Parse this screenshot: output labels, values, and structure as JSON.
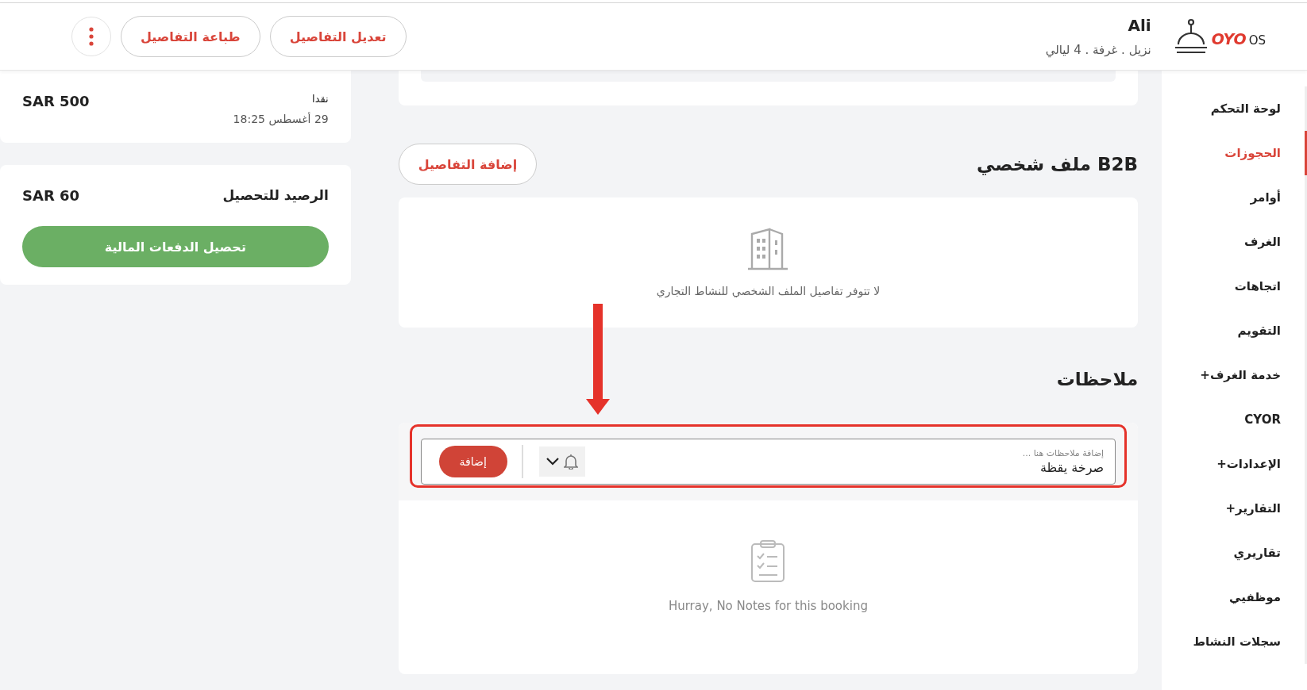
{
  "header": {
    "logo": {
      "mark": "OYO",
      "suffix": "OS"
    },
    "guest_name": "Ali",
    "stay_summary": "نزيل . غرفة . 4 ليالي",
    "buttons": [
      {
        "label": "تعديل التفاصيل"
      },
      {
        "label": "طباعة التفاصيل"
      }
    ]
  },
  "sidebar": {
    "items": [
      {
        "label": "لوحة التحكم",
        "selected": false
      },
      {
        "label": "الحجوزات",
        "selected": true
      },
      {
        "label": "أوامر",
        "selected": false
      },
      {
        "label": "الغرف",
        "selected": false
      },
      {
        "label": "اتجاهات",
        "selected": false
      },
      {
        "label": "التقويم",
        "selected": false
      },
      {
        "label": "خدمة الغرف+",
        "selected": false
      },
      {
        "label": "CYOR",
        "selected": false
      },
      {
        "label": "الإعدادات+",
        "selected": false
      },
      {
        "label": "التقارير+",
        "selected": false
      },
      {
        "label": "تقاريري",
        "selected": false
      },
      {
        "label": "موظفيي",
        "selected": false
      },
      {
        "label": "سجلات النشاط",
        "selected": false
      }
    ]
  },
  "payments": {
    "entries": [
      {
        "method": "نقدا",
        "date": "29 أغسطس 18:25",
        "amount": "SAR 500"
      }
    ]
  },
  "balance": {
    "label": "الرصيد للتحصيل",
    "amount": "SAR 60",
    "button": "تحصيل الدفعات المالية"
  },
  "b2b_profile": {
    "title": "B2B ملف شخصي",
    "button": "إضافة التفاصيل",
    "empty_text": "لا تتوفر تفاصيل الملف الشخصي للنشاط التجاري"
  },
  "notes": {
    "title": "ملاحظات",
    "input": {
      "label": "إضافة ملاحظات هنا ...",
      "value": "صرخة يقظة"
    },
    "add_button": "إضافة",
    "empty_text": "Hurray, No Notes for this booking"
  }
}
